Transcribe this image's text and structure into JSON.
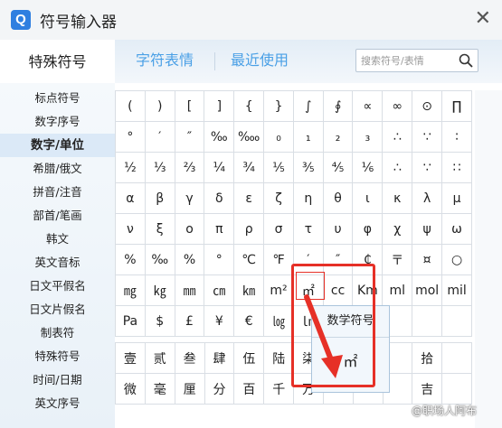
{
  "window": {
    "logo": "Q",
    "title": "符号输入器",
    "close": "✕"
  },
  "tabs": [
    "特殊符号",
    "字符表情",
    "最近使用"
  ],
  "search": {
    "placeholder": "搜索符号/表情"
  },
  "sidebar": [
    "标点符号",
    "数字序号",
    "数字/单位",
    "希腊/俄文",
    "拼音/注音",
    "部首/笔画",
    "韩文",
    "英文音标",
    "日文平假名",
    "日文片假名",
    "制表符",
    "特殊符号",
    "时间/日期",
    "英文序号"
  ],
  "sidebar_active": "数字/单位",
  "grid_rows": [
    [
      "(",
      ")",
      "[",
      "]",
      "{",
      "}",
      "∫",
      "∮",
      "∝",
      "∞",
      "⊙",
      "∏"
    ],
    [
      "°",
      "′",
      "″",
      "‰",
      "‱",
      "₀",
      "₁",
      "₂",
      "₃",
      "∴",
      "∵",
      "∶"
    ],
    [
      "½",
      "⅓",
      "⅔",
      "¼",
      "¾",
      "⅕",
      "⅗",
      "⅘",
      "⅙",
      "∴",
      "∵",
      "∷"
    ],
    [
      "α",
      "β",
      "γ",
      "δ",
      "ε",
      "ζ",
      "η",
      "θ",
      "ι",
      "κ",
      "λ",
      "μ"
    ],
    [
      "ν",
      "ξ",
      "ο",
      "π",
      "ρ",
      "σ",
      "τ",
      "υ",
      "φ",
      "χ",
      "ψ",
      "ω"
    ],
    [
      "%",
      "‰",
      "%",
      "°",
      "℃",
      "℉",
      "′",
      "″",
      "₵",
      "〒",
      "¤",
      "○"
    ],
    [
      "㎎",
      "㎏",
      "㎜",
      "㎝",
      "㎞",
      "m²",
      "㎡",
      "cc",
      "Km",
      "ml",
      "mol",
      "mil"
    ],
    [
      "Pa",
      "$",
      "£",
      "¥",
      "€",
      "㏒",
      "㏑",
      "",
      "",
      "",
      "",
      ""
    ]
  ],
  "grid_rows_2": [
    [
      "壹",
      "贰",
      "叁",
      "肆",
      "伍",
      "陆",
      "柒",
      "",
      "",
      "",
      "拾",
      ""
    ],
    [
      "微",
      "毫",
      "厘",
      "分",
      "百",
      "千",
      "万",
      "",
      "",
      "",
      "吉",
      ""
    ]
  ],
  "tooltip": {
    "title": "数学符号",
    "symbol": "㎡"
  },
  "watermark": "@职场人阿布"
}
